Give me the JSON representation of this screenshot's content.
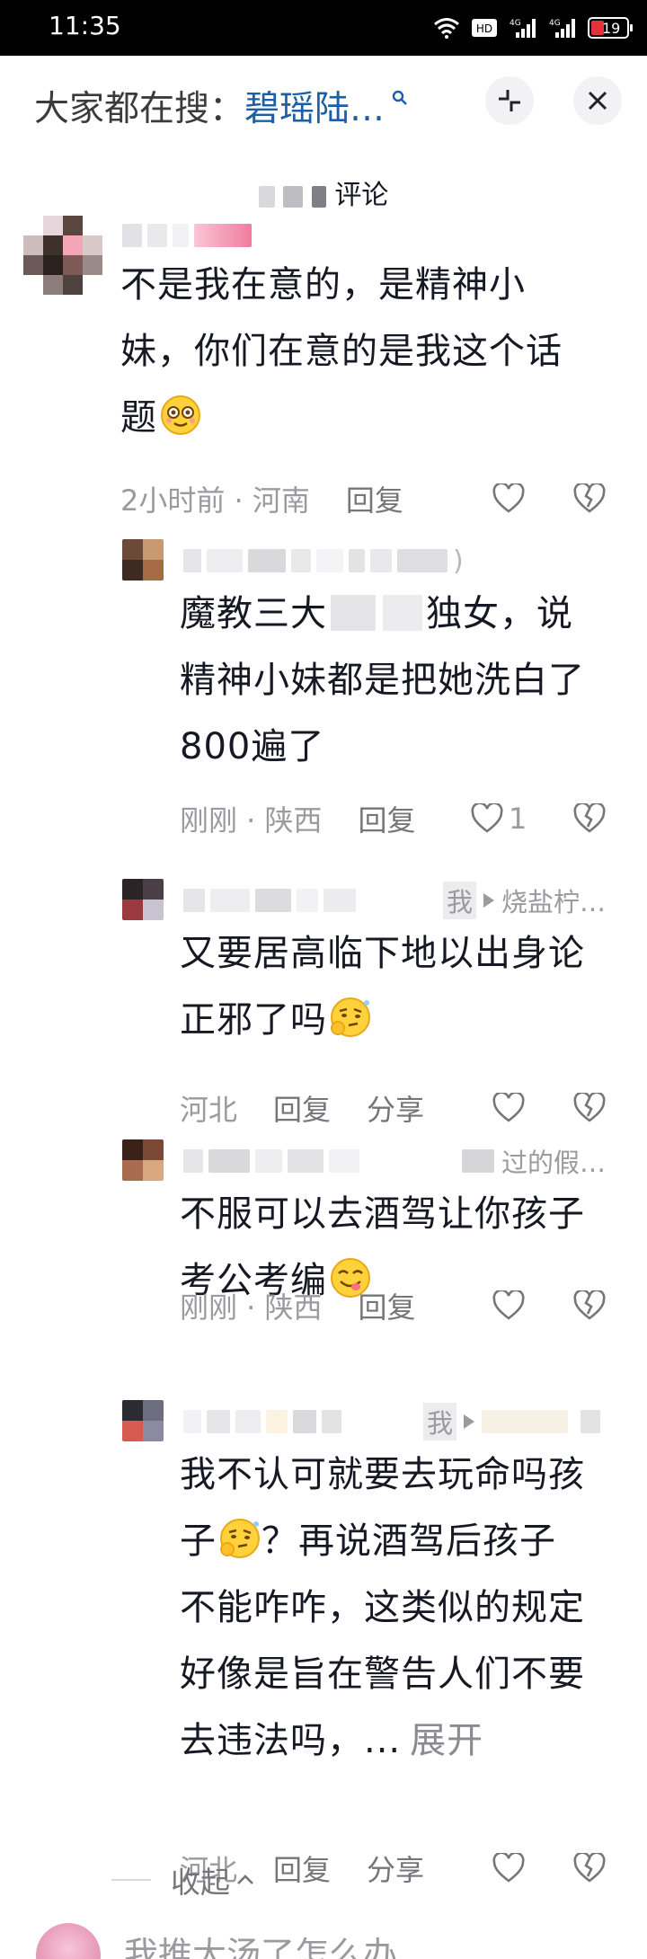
{
  "status_bar": {
    "time": "11:35",
    "battery": "19"
  },
  "header": {
    "search_prefix": "大家都在搜：",
    "search_term": "碧瑶陆…"
  },
  "section": {
    "title_suffix": "评论"
  },
  "comments": [
    {
      "text": "不是我在意的，是精神小妹，你们在意的是我这个话题",
      "lines": [
        "不是我在意的，是精神小",
        "妹，你们在意的是我这个话",
        "题"
      ],
      "meta": "2小时前 · 河南",
      "reply_label": "回复",
      "like_count": ""
    },
    {
      "name_suffix": ")",
      "lines": [
        "魔教三大",
        "独女，说",
        "精神小妹都是把她洗白了",
        "800遍了"
      ],
      "meta": "刚刚 · 陕西",
      "reply_label": "回复",
      "like_count": "1"
    },
    {
      "reply_to_me": "我",
      "reply_target": "烧盐柠…",
      "lines": [
        "又要居高临下地以出身论",
        "正邪了吗"
      ],
      "meta": "河北",
      "reply_label": "回复",
      "share_label": "分享"
    },
    {
      "reply_target": "过的假…",
      "lines": [
        "不服可以去酒驾让你孩子",
        "考公考编"
      ],
      "meta": "刚刚 · 陕西",
      "reply_label": "回复"
    },
    {
      "reply_to_me": "我",
      "lines": [
        "我不认可就要去玩命吗孩",
        "子",
        "？再说酒驾后孩子",
        "不能咋咋，这类似的规定",
        "好像是旨在警告人们不要",
        "去违法吗，..."
      ],
      "expand_label": "展开",
      "meta": "河北",
      "reply_label": "回复",
      "share_label": "分享"
    }
  ],
  "collapse_label": "收起",
  "next_comment": {
    "text": "我推大汤了怎么办"
  },
  "colors": {
    "link": "#1c5ea7",
    "muted": "#9a9a9f",
    "text": "#161823"
  }
}
